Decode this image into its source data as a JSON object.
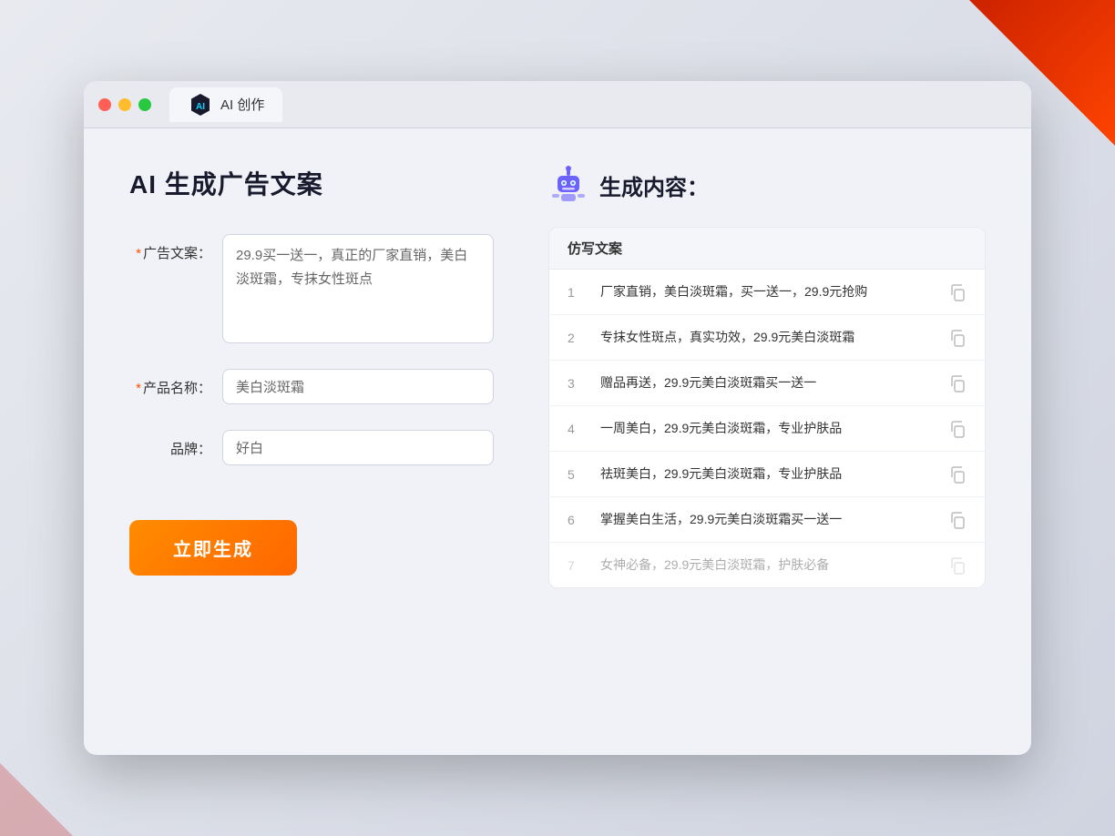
{
  "window": {
    "tab_label": "AI 创作"
  },
  "page": {
    "title": "AI 生成广告文案"
  },
  "form": {
    "ad_copy_label": "广告文案：",
    "ad_copy_required": true,
    "ad_copy_value": "29.9买一送一，真正的厂家直销，美白淡斑霜，专抹女性斑点",
    "product_name_label": "产品名称：",
    "product_name_required": true,
    "product_name_value": "美白淡斑霜",
    "brand_label": "品牌：",
    "brand_required": false,
    "brand_value": "好白",
    "generate_button": "立即生成"
  },
  "result": {
    "header": "生成内容：",
    "column_header": "仿写文案",
    "items": [
      {
        "num": "1",
        "text": "厂家直销，美白淡斑霜，买一送一，29.9元抢购"
      },
      {
        "num": "2",
        "text": "专抹女性斑点，真实功效，29.9元美白淡斑霜"
      },
      {
        "num": "3",
        "text": "赠品再送，29.9元美白淡斑霜买一送一"
      },
      {
        "num": "4",
        "text": "一周美白，29.9元美白淡斑霜，专业护肤品"
      },
      {
        "num": "5",
        "text": "祛斑美白，29.9元美白淡斑霜，专业护肤品"
      },
      {
        "num": "6",
        "text": "掌握美白生活，29.9元美白淡斑霜买一送一"
      },
      {
        "num": "7",
        "text": "女神必备，29.9元美白淡斑霜，护肤必备",
        "dimmed": true
      }
    ]
  }
}
